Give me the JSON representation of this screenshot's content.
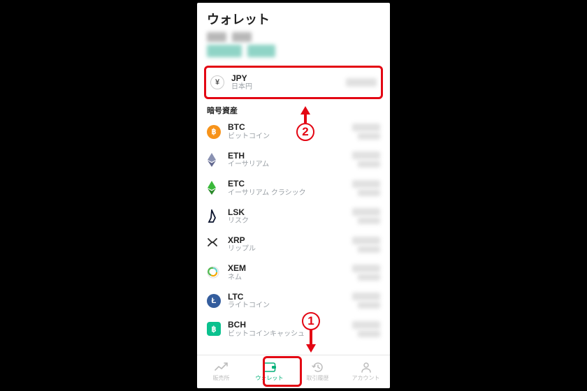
{
  "title": "ウォレット",
  "section_crypto": "暗号資産",
  "jpy": {
    "symbol": "JPY",
    "name": "日本円"
  },
  "assets": [
    {
      "symbol": "BTC",
      "name": "ビットコイン",
      "bg": "#f7931a",
      "glyph": "฿",
      "shape": "round"
    },
    {
      "symbol": "ETH",
      "name": "イーサリアム",
      "bg": "#ffffff",
      "glyph": "eth",
      "shape": "none"
    },
    {
      "symbol": "ETC",
      "name": "イーサリアム クラシック",
      "bg": "#ffffff",
      "glyph": "etc",
      "shape": "none"
    },
    {
      "symbol": "LSK",
      "name": "リスク",
      "bg": "#ffffff",
      "glyph": "lsk",
      "shape": "none"
    },
    {
      "symbol": "XRP",
      "name": "リップル",
      "bg": "#ffffff",
      "glyph": "xrp",
      "shape": "none"
    },
    {
      "symbol": "XEM",
      "name": "ネム",
      "bg": "#ffffff",
      "glyph": "xem",
      "shape": "none"
    },
    {
      "symbol": "LTC",
      "name": "ライトコイン",
      "bg": "#345d9d",
      "glyph": "Ł",
      "shape": "round"
    },
    {
      "symbol": "BCH",
      "name": "ビットコインキャッシュ",
      "bg": "#0ac18e",
      "glyph": "฿",
      "shape": "sq"
    }
  ],
  "tabs": [
    {
      "label": "販売所",
      "icon": "chart"
    },
    {
      "label": "ウォレット",
      "icon": "wallet"
    },
    {
      "label": "取引履歴",
      "icon": "history"
    },
    {
      "label": "アカウント",
      "icon": "account"
    }
  ],
  "annotations": {
    "step1": "1",
    "step2": "2"
  },
  "colors": {
    "accent": "#06b17a",
    "highlight": "#e30613"
  }
}
